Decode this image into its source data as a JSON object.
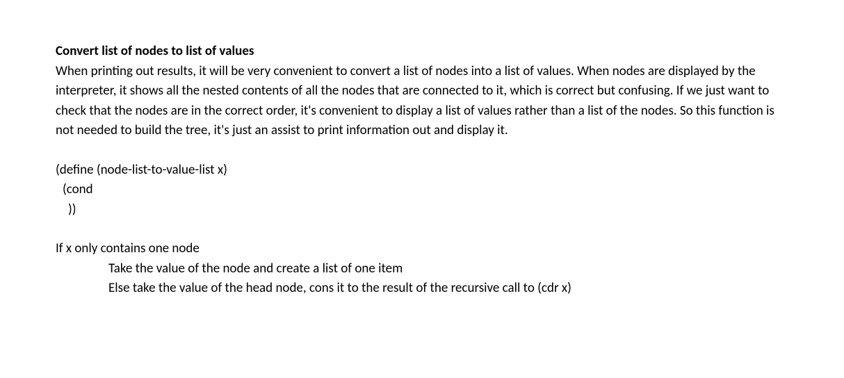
{
  "heading": "Convert list of nodes to list of values",
  "paragraph": "When printing out results, it will be very convenient to convert a list of nodes into a list of values. When nodes are displayed by the interpreter, it shows all the nested contents of all the nodes that are connected to it, which is correct but confusing. If we just want to check that the nodes are in the correct order, it's convenient to display a list of values rather than a list of the nodes. So this function is not needed to build the tree, it's just an assist to print information out and display it.",
  "code": {
    "line1": "(define (node-list-to-value-list x)",
    "line2": "(cond",
    "line3": "))"
  },
  "pseudo": {
    "line1": "If x only contains one node",
    "line2": "Take the value of the node and create a list of one item",
    "line3": "Else take the value of the head node, cons it to the result of the recursive call to (cdr x)"
  }
}
